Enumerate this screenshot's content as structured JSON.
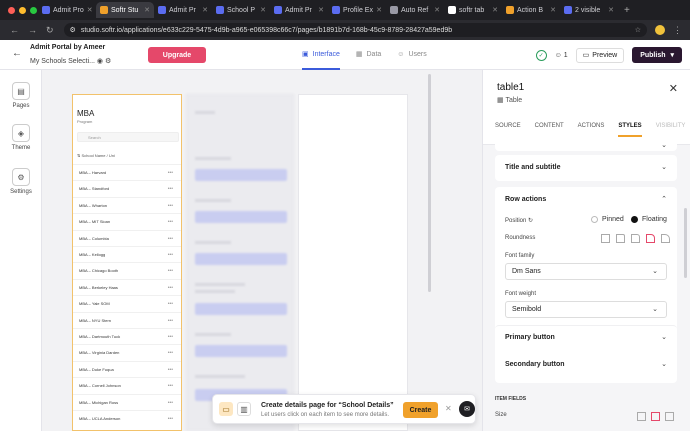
{
  "browser": {
    "tabs": [
      {
        "label": "Admit Pro",
        "color": "#5b6cf0"
      },
      {
        "label": "Softr Stu",
        "color": "#f0a12b",
        "active": true
      },
      {
        "label": "Admit Pr",
        "color": "#5b6cf0"
      },
      {
        "label": "School P",
        "color": "#5b6cf0"
      },
      {
        "label": "Admit Pr",
        "color": "#5b6cf0"
      },
      {
        "label": "Profile Ex",
        "color": "#5b6cf0"
      },
      {
        "label": "Auto Ref",
        "color": "#9a9aa6"
      },
      {
        "label": "softr tab",
        "color": "#ffffff"
      },
      {
        "label": "Action B",
        "color": "#f0a12b"
      },
      {
        "label": "2 visible",
        "color": "#5b6cf0"
      }
    ],
    "url": "studio.softr.io/applications/e633c229-5475-4d9b-a965-e065398c66c7/pages/b1891b7d-168b-45c9-8789-28427a59ed9b"
  },
  "header": {
    "app_name": "Admit Portal by Ameer",
    "page_path": "My Schools Selecti...",
    "upgrade_label": "Upgrade",
    "tabs": [
      {
        "label": "Interface",
        "active": true
      },
      {
        "label": "Data"
      },
      {
        "label": "Users"
      }
    ],
    "user_count": "1",
    "preview_label": "Preview",
    "publish_label": "Publish"
  },
  "rail": {
    "items": [
      {
        "label": "Pages"
      },
      {
        "label": "Theme"
      },
      {
        "label": "Settings"
      }
    ]
  },
  "canvas": {
    "page_title": "MBA",
    "page_subtitle": "Program",
    "search_placeholder": "Search",
    "sort_label": "School Name / Uni",
    "rows": [
      "MBA – Harvard",
      "MBA – Standford",
      "MBA – Wharton",
      "MBA – MIT Sloan",
      "MBA – Columbia",
      "MBA – Kellogg",
      "MBA – Chicago Booth",
      "MBA – Berkeley Haas",
      "MBA – Yale SOM",
      "MBA – NYU Stern",
      "MBA – Dartmouth Tuck",
      "MBA – Virginia Darden",
      "MBA – Duke Fuqua",
      "MBA – Cornell Johnson",
      "MBA – Michigan Ross",
      "MBA – UCLA Anderson"
    ]
  },
  "toast": {
    "title": "Create details page for “School Details”",
    "subtitle": "Let users click on each item to see more details.",
    "create_label": "Create"
  },
  "panel": {
    "title": "table1",
    "type": "Table",
    "tabs": [
      "SOURCE",
      "CONTENT",
      "ACTIONS",
      "STYLES",
      "VISIBILITY"
    ],
    "active_tab": "STYLES",
    "title_subtitle_label": "Title and subtitle",
    "row_actions_label": "Row actions",
    "position_label": "Position",
    "position_pinned": "Pinned",
    "position_floating": "Floating",
    "roundness_label": "Roundness",
    "font_family_label": "Font family",
    "font_family_value": "Dm Sans",
    "font_weight_label": "Font weight",
    "font_weight_value": "Semibold",
    "primary_button_label": "Primary button",
    "secondary_button_label": "Secondary button",
    "item_fields_label": "ITEM FIELDS",
    "size_label": "Size"
  }
}
